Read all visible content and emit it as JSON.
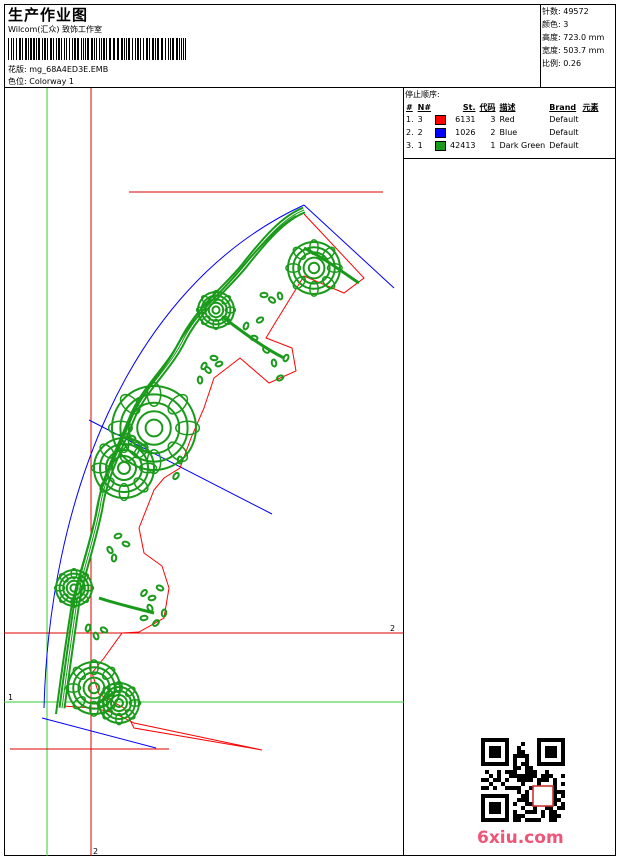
{
  "header": {
    "title": "生产作业图",
    "company": "Wilcom(汇众) 致饰工作室",
    "design_line": "花版: mg_68A4ED3E.EMB",
    "colorway_line": "色位: Colorway 1"
  },
  "stats": {
    "stitches": "针数: 49572",
    "colors": "颜色: 3",
    "height": "高度: 723.0 mm",
    "width": "宽度: 503.7 mm",
    "scale": "比例: 0.26"
  },
  "stop_sequence": {
    "title": "停止顺序:",
    "headers": [
      "#",
      "N#",
      "St.",
      "代码",
      "描述",
      "Brand",
      "元素"
    ],
    "rows": [
      {
        "idx": "1.",
        "num": "3",
        "swatch": "#ff0000",
        "stitches": "6131",
        "code": "3",
        "desc": "Red",
        "brand": "Default"
      },
      {
        "idx": "2.",
        "num": "2",
        "swatch": "#0000ff",
        "stitches": "1026",
        "code": "2",
        "desc": "Blue",
        "brand": "Default"
      },
      {
        "idx": "3.",
        "num": "1",
        "swatch": "#1a9a1a",
        "stitches": "42413",
        "code": "1",
        "desc": "Dark Green",
        "brand": "Default"
      }
    ]
  },
  "guides": {
    "h_label_1": "1",
    "h_label_2": "2",
    "v_label_2": "2"
  },
  "colors": {
    "green": "#1a9a1a",
    "red": "#ff0000",
    "blue": "#0000ff",
    "guide_green": "#33cc33",
    "guide_red": "#dd0000"
  },
  "watermark": "6xiu.com"
}
